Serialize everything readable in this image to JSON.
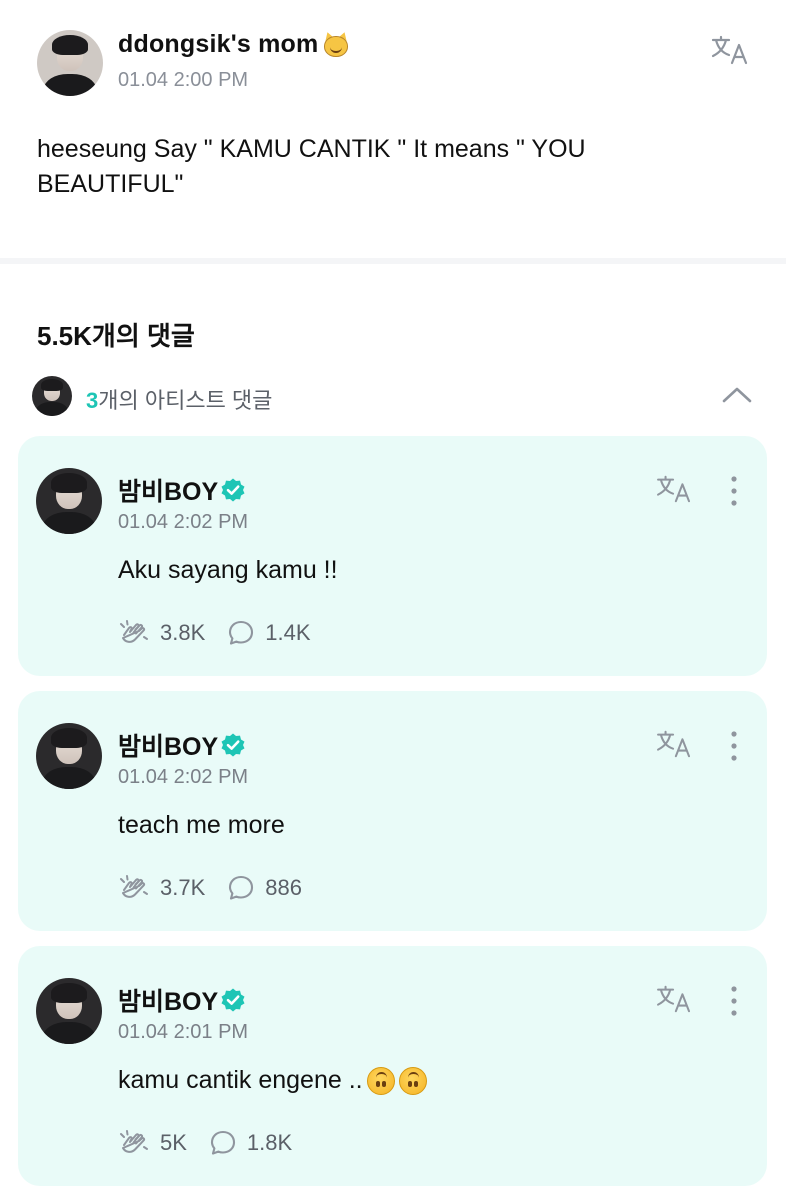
{
  "post": {
    "author": "ddongsik's mom",
    "author_emoji": "smiling-cat-emoji",
    "time": "01.04 2:00 PM",
    "text": "heeseung Say \" KAMU CANTIK \" It means \" YOU BEAUTIFUL\""
  },
  "comments_header": {
    "count_label": "5.5K개의 댓글",
    "artist_count_num": "3",
    "artist_count_suffix": "개의 아티스트 댓글"
  },
  "comments": [
    {
      "name": "밤비BOY",
      "time": "01.04 2:02 PM",
      "text": "Aku sayang kamu !!",
      "likes": "3.8K",
      "replies": "1.4K"
    },
    {
      "name": "밤비BOY",
      "time": "01.04 2:02 PM",
      "text": "teach me more",
      "likes": "3.7K",
      "replies": "886"
    },
    {
      "name": "밤비BOY",
      "time": "01.04 2:01 PM",
      "text": "kamu cantik engene ..",
      "likes": "5K",
      "replies": "1.8K"
    }
  ],
  "colors": {
    "accent_teal": "#1ec5b5",
    "card_bg": "#e9fbf8",
    "muted_text": "#8a8f98"
  }
}
